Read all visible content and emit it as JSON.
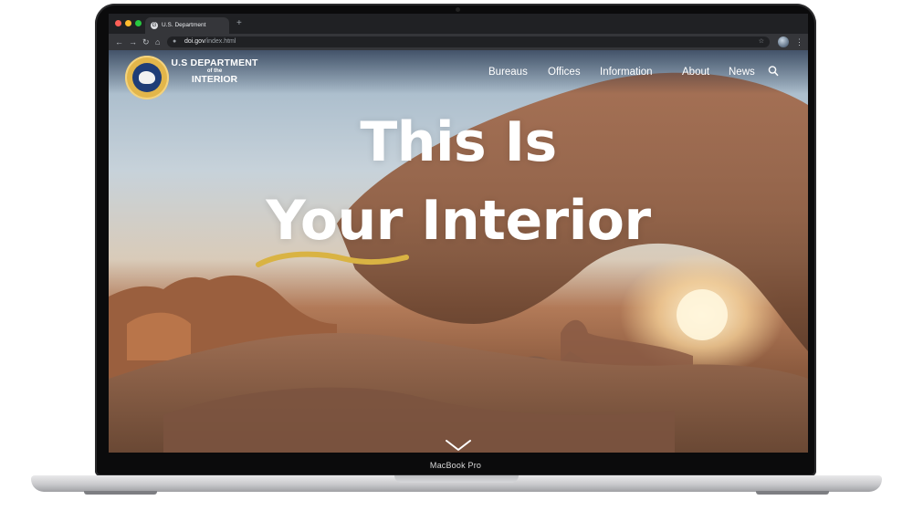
{
  "browser": {
    "tab_title": "U.S. Department",
    "tab_favicon": "G",
    "new_tab": "+",
    "url_host": "doi.gov",
    "url_path": "/index.html"
  },
  "site": {
    "brand": {
      "line1": "U.S DEPARTMENT",
      "line2": "of the",
      "line3": "INTERIOR"
    },
    "nav": [
      "Bureaus",
      "Offices",
      "Information",
      "About",
      "News"
    ]
  },
  "hero": {
    "headline_line1": "This Is",
    "headline_line2": "Your Interior",
    "accent_color": "#d9b343"
  },
  "device": {
    "label": "MacBook Pro"
  },
  "icons": [
    "back-icon",
    "forward-icon",
    "reload-icon",
    "home-icon",
    "lock-icon",
    "star-icon",
    "search-icon",
    "chevron-down-icon"
  ]
}
